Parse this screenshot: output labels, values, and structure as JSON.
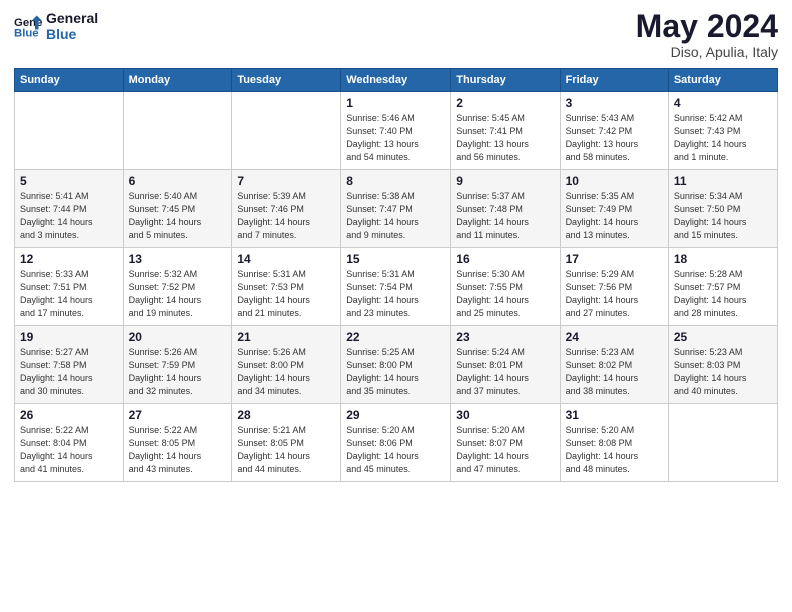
{
  "logo": {
    "line1": "General",
    "line2": "Blue"
  },
  "title": "May 2024",
  "location": "Diso, Apulia, Italy",
  "days_of_week": [
    "Sunday",
    "Monday",
    "Tuesday",
    "Wednesday",
    "Thursday",
    "Friday",
    "Saturday"
  ],
  "weeks": [
    [
      {
        "day": "",
        "info": ""
      },
      {
        "day": "",
        "info": ""
      },
      {
        "day": "",
        "info": ""
      },
      {
        "day": "1",
        "info": "Sunrise: 5:46 AM\nSunset: 7:40 PM\nDaylight: 13 hours\nand 54 minutes."
      },
      {
        "day": "2",
        "info": "Sunrise: 5:45 AM\nSunset: 7:41 PM\nDaylight: 13 hours\nand 56 minutes."
      },
      {
        "day": "3",
        "info": "Sunrise: 5:43 AM\nSunset: 7:42 PM\nDaylight: 13 hours\nand 58 minutes."
      },
      {
        "day": "4",
        "info": "Sunrise: 5:42 AM\nSunset: 7:43 PM\nDaylight: 14 hours\nand 1 minute."
      }
    ],
    [
      {
        "day": "5",
        "info": "Sunrise: 5:41 AM\nSunset: 7:44 PM\nDaylight: 14 hours\nand 3 minutes."
      },
      {
        "day": "6",
        "info": "Sunrise: 5:40 AM\nSunset: 7:45 PM\nDaylight: 14 hours\nand 5 minutes."
      },
      {
        "day": "7",
        "info": "Sunrise: 5:39 AM\nSunset: 7:46 PM\nDaylight: 14 hours\nand 7 minutes."
      },
      {
        "day": "8",
        "info": "Sunrise: 5:38 AM\nSunset: 7:47 PM\nDaylight: 14 hours\nand 9 minutes."
      },
      {
        "day": "9",
        "info": "Sunrise: 5:37 AM\nSunset: 7:48 PM\nDaylight: 14 hours\nand 11 minutes."
      },
      {
        "day": "10",
        "info": "Sunrise: 5:35 AM\nSunset: 7:49 PM\nDaylight: 14 hours\nand 13 minutes."
      },
      {
        "day": "11",
        "info": "Sunrise: 5:34 AM\nSunset: 7:50 PM\nDaylight: 14 hours\nand 15 minutes."
      }
    ],
    [
      {
        "day": "12",
        "info": "Sunrise: 5:33 AM\nSunset: 7:51 PM\nDaylight: 14 hours\nand 17 minutes."
      },
      {
        "day": "13",
        "info": "Sunrise: 5:32 AM\nSunset: 7:52 PM\nDaylight: 14 hours\nand 19 minutes."
      },
      {
        "day": "14",
        "info": "Sunrise: 5:31 AM\nSunset: 7:53 PM\nDaylight: 14 hours\nand 21 minutes."
      },
      {
        "day": "15",
        "info": "Sunrise: 5:31 AM\nSunset: 7:54 PM\nDaylight: 14 hours\nand 23 minutes."
      },
      {
        "day": "16",
        "info": "Sunrise: 5:30 AM\nSunset: 7:55 PM\nDaylight: 14 hours\nand 25 minutes."
      },
      {
        "day": "17",
        "info": "Sunrise: 5:29 AM\nSunset: 7:56 PM\nDaylight: 14 hours\nand 27 minutes."
      },
      {
        "day": "18",
        "info": "Sunrise: 5:28 AM\nSunset: 7:57 PM\nDaylight: 14 hours\nand 28 minutes."
      }
    ],
    [
      {
        "day": "19",
        "info": "Sunrise: 5:27 AM\nSunset: 7:58 PM\nDaylight: 14 hours\nand 30 minutes."
      },
      {
        "day": "20",
        "info": "Sunrise: 5:26 AM\nSunset: 7:59 PM\nDaylight: 14 hours\nand 32 minutes."
      },
      {
        "day": "21",
        "info": "Sunrise: 5:26 AM\nSunset: 8:00 PM\nDaylight: 14 hours\nand 34 minutes."
      },
      {
        "day": "22",
        "info": "Sunrise: 5:25 AM\nSunset: 8:00 PM\nDaylight: 14 hours\nand 35 minutes."
      },
      {
        "day": "23",
        "info": "Sunrise: 5:24 AM\nSunset: 8:01 PM\nDaylight: 14 hours\nand 37 minutes."
      },
      {
        "day": "24",
        "info": "Sunrise: 5:23 AM\nSunset: 8:02 PM\nDaylight: 14 hours\nand 38 minutes."
      },
      {
        "day": "25",
        "info": "Sunrise: 5:23 AM\nSunset: 8:03 PM\nDaylight: 14 hours\nand 40 minutes."
      }
    ],
    [
      {
        "day": "26",
        "info": "Sunrise: 5:22 AM\nSunset: 8:04 PM\nDaylight: 14 hours\nand 41 minutes."
      },
      {
        "day": "27",
        "info": "Sunrise: 5:22 AM\nSunset: 8:05 PM\nDaylight: 14 hours\nand 43 minutes."
      },
      {
        "day": "28",
        "info": "Sunrise: 5:21 AM\nSunset: 8:05 PM\nDaylight: 14 hours\nand 44 minutes."
      },
      {
        "day": "29",
        "info": "Sunrise: 5:20 AM\nSunset: 8:06 PM\nDaylight: 14 hours\nand 45 minutes."
      },
      {
        "day": "30",
        "info": "Sunrise: 5:20 AM\nSunset: 8:07 PM\nDaylight: 14 hours\nand 47 minutes."
      },
      {
        "day": "31",
        "info": "Sunrise: 5:20 AM\nSunset: 8:08 PM\nDaylight: 14 hours\nand 48 minutes."
      },
      {
        "day": "",
        "info": ""
      }
    ]
  ]
}
